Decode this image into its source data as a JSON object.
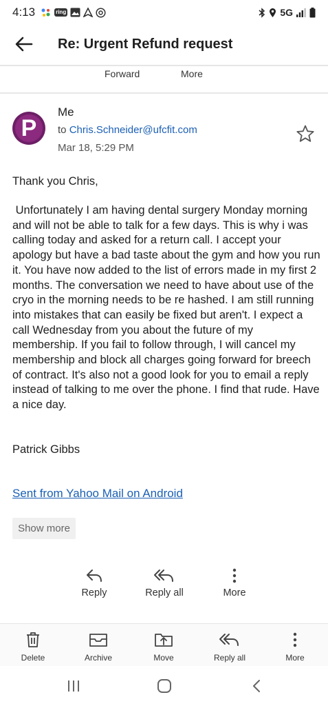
{
  "status_bar": {
    "time": "4:13",
    "ring_label": "ring",
    "network": "5G"
  },
  "app_bar": {
    "title": "Re: Urgent Refund request"
  },
  "top_strip": {
    "forward_label": "Forward",
    "more_label": "More"
  },
  "message": {
    "sender_name": "Me",
    "avatar_letter": "P",
    "to_prefix": "to",
    "recipient": "Chris.Schneider@ufcfit.com",
    "date": "Mar 18, 5:29 PM",
    "greeting": "Thank you Chris,",
    "body": " Unfortunately I am having dental surgery Monday morning and will not be able to talk for a few days. This is why i was calling today and asked for a return call. I accept your apology but have a bad taste about the gym and how you run it. You have now added to the list of errors made in my first 2 months. The conversation we need to have about use of the cryo in the morning needs to be re hashed. I am still running into mistakes that can easily be fixed but aren't. I expect a call Wednesday from you about the future of my membership. If you fail to follow through, I will cancel my membership and block all charges going forward for breech of contract. It's also not a good look for you to email a reply instead of talking to me over the phone. I find that rude. Have a nice day.",
    "signature": "Patrick Gibbs",
    "link_text": "Sent from Yahoo Mail on Android",
    "show_more_label": "Show more"
  },
  "reply_actions": {
    "reply_label": "Reply",
    "reply_all_label": "Reply all",
    "more_label": "More"
  },
  "bottom_bar": {
    "delete_label": "Delete",
    "archive_label": "Archive",
    "move_label": "Move",
    "reply_all_label": "Reply all",
    "more_label": "More"
  },
  "colors": {
    "accent_link": "#1a5fb4",
    "avatar": "#8c2a7f"
  }
}
